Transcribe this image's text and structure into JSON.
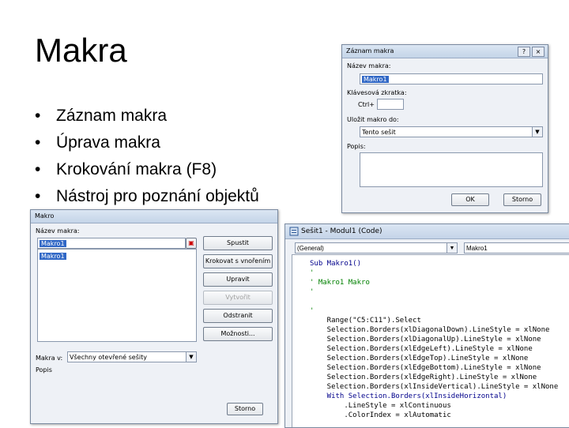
{
  "slide": {
    "title": "Makra",
    "bullets": [
      "Záznam makra",
      "Úprava makra",
      "Krokování makra (F8)",
      "Nástroj pro poznání objektů"
    ]
  },
  "record_dialog": {
    "title": "Záznam makra",
    "close": "×",
    "name_label": "Název makra:",
    "name_value": "Makro1",
    "shortcut_label": "Klávesová zkratka:",
    "shortcut_value": "Ctrl+",
    "store_label": "Uložit makro do:",
    "store_value": "Tento sešit",
    "desc_label": "Popis:",
    "ok": "OK",
    "cancel": "Storno"
  },
  "macro_dialog": {
    "title": "Makro",
    "name_label": "Název makra:",
    "name_value": "Makro1",
    "list_items": [
      "Makro1"
    ],
    "buttons": {
      "run": "Spustit",
      "step": "Krokovat s vnořením",
      "edit": "Upravit",
      "create": "Vytvořit",
      "delete": "Odstranit",
      "options": "Možnosti..."
    },
    "macros_in_label": "Makra v:",
    "macros_in_value": "Všechny otevřené sešity",
    "desc_label": "Popis",
    "cancel": "Storno"
  },
  "code_window": {
    "title": "Sešit1 - Modul1 (Code)",
    "object_dropdown": "(General)",
    "proc_dropdown": "Makro1",
    "lines": [
      {
        "text": "Sub Makro1()",
        "kind": "kw"
      },
      {
        "text": "'",
        "kind": "cm"
      },
      {
        "text": "' Makro1 Makro",
        "kind": "cm"
      },
      {
        "text": "'",
        "kind": "cm"
      },
      {
        "text": "",
        "kind": "pl"
      },
      {
        "text": "'",
        "kind": "cm"
      },
      {
        "text": "    Range(\"C5:C11\").Select",
        "kind": "pl"
      },
      {
        "text": "    Selection.Borders(xlDiagonalDown).LineStyle = xlNone",
        "kind": "pl"
      },
      {
        "text": "    Selection.Borders(xlDiagonalUp).LineStyle = xlNone",
        "kind": "pl"
      },
      {
        "text": "    Selection.Borders(xlEdgeLeft).LineStyle = xlNone",
        "kind": "pl"
      },
      {
        "text": "    Selection.Borders(xlEdgeTop).LineStyle = xlNone",
        "kind": "pl"
      },
      {
        "text": "    Selection.Borders(xlEdgeBottom).LineStyle = xlNone",
        "kind": "pl"
      },
      {
        "text": "    Selection.Borders(xlEdgeRight).LineStyle = xlNone",
        "kind": "pl"
      },
      {
        "text": "    Selection.Borders(xlInsideVertical).LineStyle = xlNone",
        "kind": "pl"
      },
      {
        "text": "    With Selection.Borders(xlInsideHorizontal)",
        "kind": "kw"
      },
      {
        "text": "        .LineStyle = xlContinuous",
        "kind": "pl"
      },
      {
        "text": "        .ColorIndex = xlAutomatic",
        "kind": "pl"
      }
    ]
  }
}
